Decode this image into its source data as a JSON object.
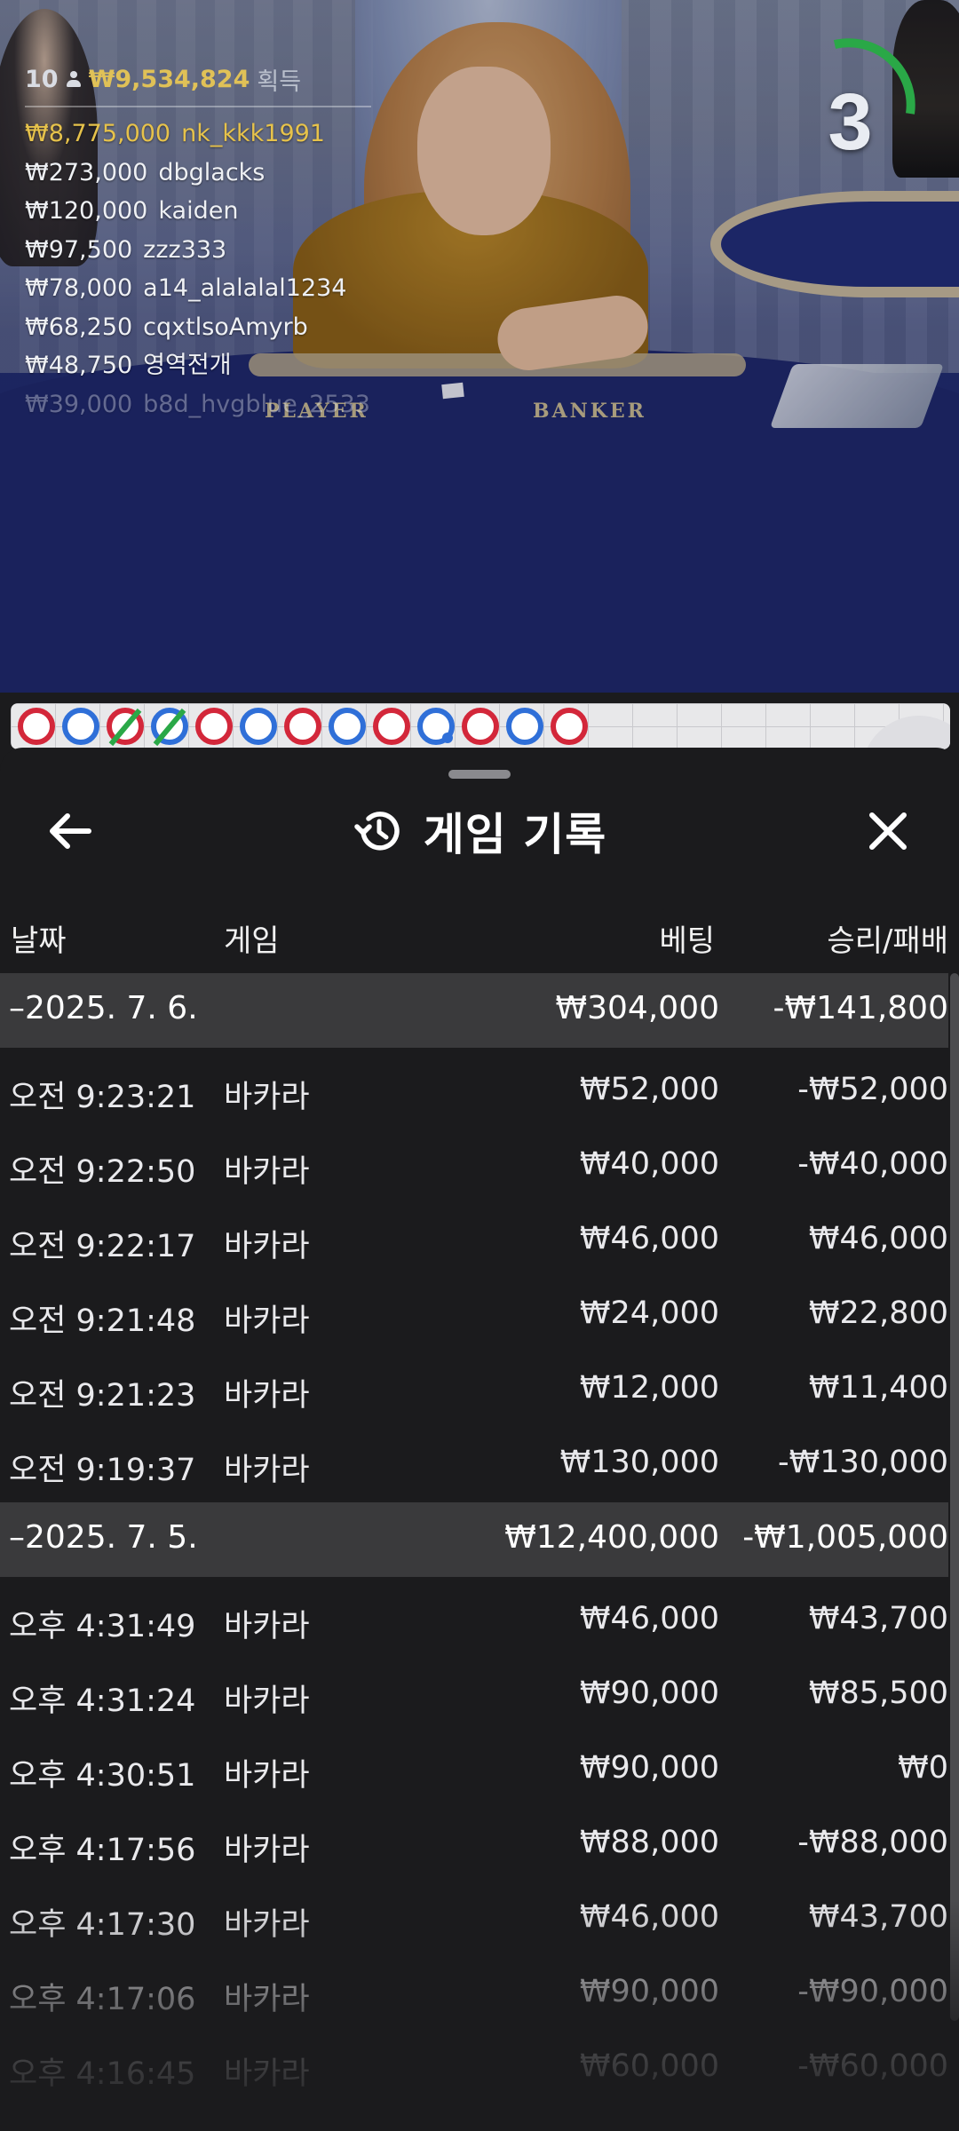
{
  "live_overlay": {
    "player_count": "10",
    "total_winnings": "₩9,534,824",
    "total_label": "획득",
    "winners": [
      {
        "amount": "₩8,775,000",
        "name": "nk_kkk1991"
      },
      {
        "amount": "₩273,000",
        "name": "dbglacks"
      },
      {
        "amount": "₩120,000",
        "name": "kaiden"
      },
      {
        "amount": "₩97,500",
        "name": "zzz333"
      },
      {
        "amount": "₩78,000",
        "name": "a14_alalalal1234"
      },
      {
        "amount": "₩68,250",
        "name": "cqxtlsoAmyrb"
      },
      {
        "amount": "₩48,750",
        "name": "영역전개"
      },
      {
        "amount": "₩39,000",
        "name": "b8d_hvgblue_2533"
      }
    ],
    "countdown": "3",
    "felt_player": "PLAYER",
    "felt_banker": "BANKER"
  },
  "bead_road": [
    "B",
    "P",
    "B",
    "P",
    "B",
    "P",
    "B",
    "P",
    "B",
    "P",
    "B",
    "P",
    "B"
  ],
  "colors": {
    "banker": "#d3273a",
    "player": "#2f6fd8",
    "tie": "#2aa847",
    "gold": "#e0c157",
    "sheet_bg": "#1b1b1d",
    "group_bg": "#3a3a3c"
  },
  "sheet": {
    "title": "게임 기록",
    "icons": {
      "back": "arrow-left-icon",
      "title": "history-icon",
      "close": "close-icon"
    },
    "columns": {
      "date": "날짜",
      "game": "게임",
      "bet": "베팅",
      "win_loss": "승리/패배"
    },
    "groups": [
      {
        "date": "–2025. 7. 6.",
        "bet": "₩304,000",
        "win_loss": "-₩141,800",
        "rows": [
          {
            "time": "오전 9:23:21",
            "game": "바카라",
            "bet": "₩52,000",
            "win_loss": "-₩52,000"
          },
          {
            "time": "오전 9:22:50",
            "game": "바카라",
            "bet": "₩40,000",
            "win_loss": "-₩40,000"
          },
          {
            "time": "오전 9:22:17",
            "game": "바카라",
            "bet": "₩46,000",
            "win_loss": "₩46,000"
          },
          {
            "time": "오전 9:21:48",
            "game": "바카라",
            "bet": "₩24,000",
            "win_loss": "₩22,800"
          },
          {
            "time": "오전 9:21:23",
            "game": "바카라",
            "bet": "₩12,000",
            "win_loss": "₩11,400"
          },
          {
            "time": "오전 9:19:37",
            "game": "바카라",
            "bet": "₩130,000",
            "win_loss": "-₩130,000"
          }
        ]
      },
      {
        "date": "–2025. 7. 5.",
        "bet": "₩12,400,000",
        "win_loss": "-₩1,005,000",
        "rows": [
          {
            "time": "오후 4:31:49",
            "game": "바카라",
            "bet": "₩46,000",
            "win_loss": "₩43,700"
          },
          {
            "time": "오후 4:31:24",
            "game": "바카라",
            "bet": "₩90,000",
            "win_loss": "₩85,500"
          },
          {
            "time": "오후 4:30:51",
            "game": "바카라",
            "bet": "₩90,000",
            "win_loss": "₩0"
          },
          {
            "time": "오후 4:17:56",
            "game": "바카라",
            "bet": "₩88,000",
            "win_loss": "-₩88,000"
          },
          {
            "time": "오후 4:17:30",
            "game": "바카라",
            "bet": "₩46,000",
            "win_loss": "₩43,700"
          },
          {
            "time": "오후 4:17:06",
            "game": "바카라",
            "bet": "₩90,000",
            "win_loss": "-₩90,000"
          },
          {
            "time": "오후 4:16:45",
            "game": "바카라",
            "bet": "₩60,000",
            "win_loss": "-₩60,000"
          }
        ]
      }
    ]
  }
}
